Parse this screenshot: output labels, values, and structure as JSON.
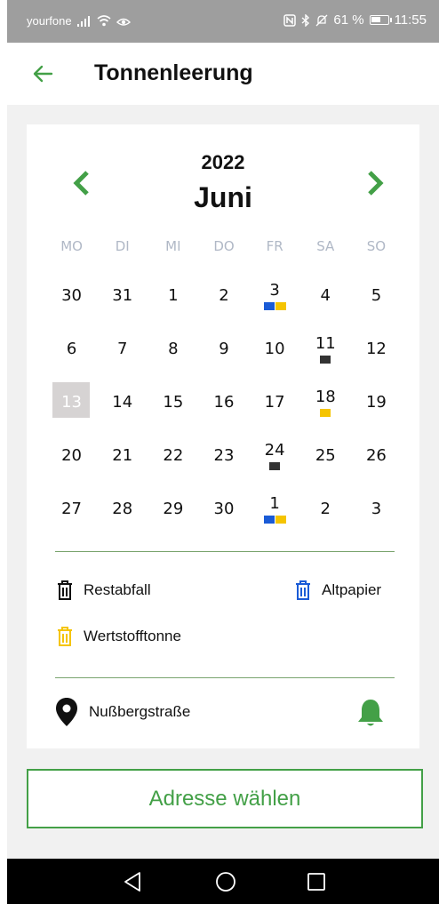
{
  "status": {
    "carrier": "yourfone",
    "battery": "61 %",
    "battery_level": 0.61,
    "time": "11:55"
  },
  "header": {
    "title": "Tonnenleerung",
    "back_icon": "arrow-left-icon"
  },
  "calendar": {
    "year": "2022",
    "month": "Juni",
    "weekdays": [
      "MO",
      "DI",
      "MI",
      "DO",
      "FR",
      "SA",
      "SO"
    ],
    "today": "13",
    "weeks": [
      [
        {
          "d": "30",
          "m": []
        },
        {
          "d": "31",
          "m": []
        },
        {
          "d": "1",
          "m": []
        },
        {
          "d": "2",
          "m": []
        },
        {
          "d": "3",
          "m": [
            "blue",
            "yellow"
          ]
        },
        {
          "d": "4",
          "m": []
        },
        {
          "d": "5",
          "m": []
        }
      ],
      [
        {
          "d": "6",
          "m": []
        },
        {
          "d": "7",
          "m": []
        },
        {
          "d": "8",
          "m": []
        },
        {
          "d": "9",
          "m": []
        },
        {
          "d": "10",
          "m": []
        },
        {
          "d": "11",
          "m": [
            "black"
          ]
        },
        {
          "d": "12",
          "m": []
        }
      ],
      [
        {
          "d": "13",
          "m": [],
          "today": true
        },
        {
          "d": "14",
          "m": []
        },
        {
          "d": "15",
          "m": []
        },
        {
          "d": "16",
          "m": []
        },
        {
          "d": "17",
          "m": []
        },
        {
          "d": "18",
          "m": [
            "yellow"
          ]
        },
        {
          "d": "19",
          "m": []
        }
      ],
      [
        {
          "d": "20",
          "m": []
        },
        {
          "d": "21",
          "m": []
        },
        {
          "d": "22",
          "m": []
        },
        {
          "d": "23",
          "m": []
        },
        {
          "d": "24",
          "m": [
            "black"
          ]
        },
        {
          "d": "25",
          "m": []
        },
        {
          "d": "26",
          "m": []
        }
      ],
      [
        {
          "d": "27",
          "m": []
        },
        {
          "d": "28",
          "m": []
        },
        {
          "d": "29",
          "m": []
        },
        {
          "d": "30",
          "m": []
        },
        {
          "d": "1",
          "m": [
            "blue",
            "yellow"
          ]
        },
        {
          "d": "2",
          "m": []
        },
        {
          "d": "3",
          "m": []
        }
      ]
    ]
  },
  "legend": {
    "restabfall": "Restabfall",
    "altpapier": "Altpapier",
    "wertstofftonne": "Wertstofftonne"
  },
  "address": {
    "street": "Nußbergstraße"
  },
  "actions": {
    "choose_address": "Adresse wählen"
  },
  "colors": {
    "accent": "#43a047",
    "black": "#333333",
    "blue": "#1a5bd6",
    "yellow": "#f5c400"
  }
}
